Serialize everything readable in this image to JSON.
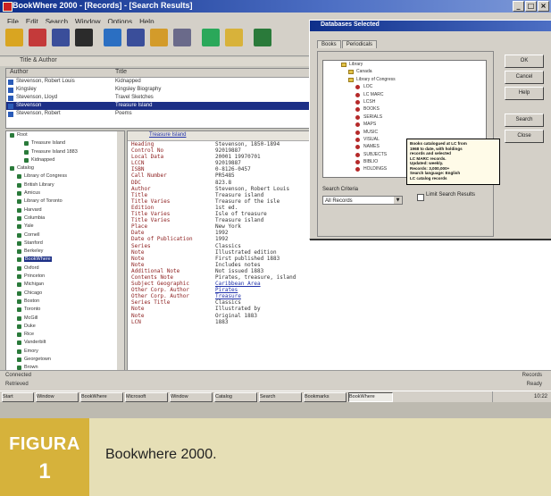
{
  "window": {
    "title": "BookWhere 2000 - [Records] - [Search Results]",
    "controls": [
      "_",
      "□",
      "×"
    ]
  },
  "menubar": [
    "File",
    "Edit",
    "Search",
    "Window",
    "Options",
    "Help"
  ],
  "toolbar": {
    "buttons": [
      {
        "name": "open-folder-icon",
        "color": "#d9a521"
      },
      {
        "name": "save-icon",
        "color": "#c43a3a"
      },
      {
        "name": "print-icon",
        "color": "#3a4e9a"
      },
      {
        "name": "help-icon",
        "color": "#2b2b2b"
      },
      {
        "name": "books-icon",
        "color": "#2b6fc2"
      },
      {
        "name": "search-icon",
        "color": "#3a4e9a"
      },
      {
        "name": "stop-icon",
        "color": "#d39b2a"
      },
      {
        "name": "view-icon",
        "color": "#6a6a8a"
      },
      {
        "name": "import-icon",
        "color": "#2aa85a"
      },
      {
        "name": "export-icon",
        "color": "#d8b23a"
      },
      {
        "name": "database-icon",
        "color": "#2a7a3a"
      }
    ]
  },
  "subheader": "Title & Author",
  "upper_list": {
    "headers": [
      "Author",
      "Title"
    ],
    "rows": [
      {
        "author": "Stevenson, Robert Louis",
        "title": "Kidnapped",
        "selected": false
      },
      {
        "author": "Kingsley",
        "title": "Kingsley Biography",
        "selected": false
      },
      {
        "author": "Stevenson, Lloyd",
        "title": "Travel Sketches",
        "selected": false
      },
      {
        "author": "Stevenson",
        "title": "Treasure Island",
        "selected": true
      },
      {
        "author": "Stevenson, Robert",
        "title": "Poems",
        "selected": false
      }
    ]
  },
  "tree": {
    "rows": [
      {
        "label": "Root",
        "indent": 0
      },
      {
        "label": "Treasure Island",
        "indent": 2
      },
      {
        "label": "Treasure Island 1883",
        "indent": 2
      },
      {
        "label": "Kidnapped",
        "indent": 2
      },
      {
        "label": "Catalog",
        "indent": 0
      },
      {
        "label": "Library of Congress",
        "indent": 1
      },
      {
        "label": "British Library",
        "indent": 1
      },
      {
        "label": "Amicus",
        "indent": 1
      },
      {
        "label": "Library of Toronto",
        "indent": 1
      },
      {
        "label": "Harvard",
        "indent": 1
      },
      {
        "label": "Columbia",
        "indent": 1
      },
      {
        "label": "Yale",
        "indent": 1
      },
      {
        "label": "Cornell",
        "indent": 1
      },
      {
        "label": "Stanford",
        "indent": 1
      },
      {
        "label": "Berkeley",
        "indent": 1
      },
      {
        "label": "BookWhere",
        "indent": 1,
        "selected": true
      },
      {
        "label": "Oxford",
        "indent": 1
      },
      {
        "label": "Princeton",
        "indent": 1
      },
      {
        "label": "Michigan",
        "indent": 1
      },
      {
        "label": "Chicago",
        "indent": 1
      },
      {
        "label": "Boston",
        "indent": 1
      },
      {
        "label": "Toronto",
        "indent": 1
      },
      {
        "label": "McGill",
        "indent": 1
      },
      {
        "label": "Duke",
        "indent": 1
      },
      {
        "label": "Rice",
        "indent": 1
      },
      {
        "label": "Vanderbilt",
        "indent": 1
      },
      {
        "label": "Emory",
        "indent": 1
      },
      {
        "label": "Georgetown",
        "indent": 1
      },
      {
        "label": "Brown",
        "indent": 1
      }
    ]
  },
  "record": {
    "header_link": "Treasure Island",
    "fields": [
      {
        "label": "Heading",
        "value": "Stevenson, 1850-1894"
      },
      {
        "label": "Control No",
        "value": "92019887"
      },
      {
        "label": "Local Data",
        "value": "20001 19970701"
      },
      {
        "label": "LCCN",
        "value": "92019887"
      },
      {
        "label": "ISBN",
        "value": "0-8126-0457"
      },
      {
        "label": "Call Number",
        "value": "PR5485"
      },
      {
        "label": "DDC",
        "value": "823.8"
      },
      {
        "label": "Author",
        "value": "Stevenson, Robert Louis"
      },
      {
        "label": "Title",
        "value": "Treasure island"
      },
      {
        "label": "Title Varies",
        "value": "Treasure of the isle"
      },
      {
        "label": "Edition",
        "value": "1st ed."
      },
      {
        "label": "Title Varies",
        "value": "Isle of treasure"
      },
      {
        "label": "Title Varies",
        "value": "Treasure island"
      },
      {
        "label": "Place",
        "value": "New York"
      },
      {
        "label": "Date",
        "value": "1992"
      },
      {
        "label": "Date of Publication",
        "value": "1992"
      },
      {
        "label": "Series",
        "value": "Classics"
      },
      {
        "label": "Note",
        "value": "Illustrated edition"
      },
      {
        "label": "Note",
        "value": "First published 1883"
      },
      {
        "label": "Note",
        "value": "Includes notes"
      },
      {
        "label": "Additional Note",
        "value": "Not issued 1883"
      },
      {
        "label": "Contents Note",
        "value": "Pirates, treasure, island"
      },
      {
        "label": "Subject Geographic",
        "value": "Caribbean Area",
        "link": true
      },
      {
        "label": "Other Corp. Author",
        "value": "Pirates",
        "link": true
      },
      {
        "label": "Other Corp. Author",
        "value": "Treasure",
        "link": true
      },
      {
        "label": "Series Title",
        "value": "Classics"
      },
      {
        "label": "Note",
        "value": "Illustrated by"
      },
      {
        "label": "Note",
        "value": "Original 1883"
      },
      {
        "label": "LCN",
        "value": "1883"
      }
    ]
  },
  "status": {
    "left1": "Connected",
    "left2": "Retrieved",
    "right1": "Records",
    "right2": "Ready"
  },
  "taskbar": {
    "items": [
      {
        "label": "Start",
        "active": false
      },
      {
        "label": "Window",
        "active": false
      },
      {
        "label": "BookWhere",
        "active": false
      },
      {
        "label": "Microsoft",
        "active": false
      },
      {
        "label": "Window",
        "active": false
      },
      {
        "label": "Catalog",
        "active": false
      },
      {
        "label": "Search",
        "active": false
      },
      {
        "label": "Bookmarks",
        "active": false
      },
      {
        "label": "BookWhere",
        "active": true
      }
    ],
    "clock": "10:22"
  },
  "dialog": {
    "title": "Databases Selected",
    "tabs": [
      "Books",
      "Periodicals"
    ],
    "tree": [
      {
        "label": "Library",
        "indent": 0,
        "type": "folder"
      },
      {
        "label": "Canada",
        "indent": 1,
        "type": "folder"
      },
      {
        "label": "Library of Congress",
        "indent": 1,
        "type": "folder"
      },
      {
        "label": "LOC",
        "indent": 2,
        "type": "bullet"
      },
      {
        "label": "LC MARC",
        "indent": 2,
        "type": "bullet"
      },
      {
        "label": "LCSH",
        "indent": 2,
        "type": "bullet"
      },
      {
        "label": "BOOKS",
        "indent": 2,
        "type": "bullet"
      },
      {
        "label": "SERIALS",
        "indent": 2,
        "type": "bullet"
      },
      {
        "label": "MAPS",
        "indent": 2,
        "type": "bullet"
      },
      {
        "label": "MUSIC",
        "indent": 2,
        "type": "bullet"
      },
      {
        "label": "VISUAL",
        "indent": 2,
        "type": "bullet"
      },
      {
        "label": "NAMES",
        "indent": 2,
        "type": "bullet"
      },
      {
        "label": "SUBJECTS",
        "indent": 2,
        "type": "bullet"
      },
      {
        "label": "BIBLIO",
        "indent": 2,
        "type": "bullet"
      },
      {
        "label": "HOLDINGS",
        "indent": 2,
        "type": "bullet"
      }
    ],
    "buttons": [
      "OK",
      "Cancel",
      "Help",
      "Search",
      "Close"
    ],
    "select_label": "Search Criteria",
    "select_value": "All Records",
    "checkbox_label": "Limit Search Results",
    "tooltip_lines": [
      "Books catalogued at LC from",
      "1968 to date, with holdings",
      "records and selected",
      "LC MARC records.",
      "Updated: weekly.",
      "Records: 3,000,000+",
      "Search language: English",
      "LC catalog records"
    ]
  },
  "caption": {
    "badge_word": "FIGURA",
    "badge_number": "1",
    "text": "Bookwhere 2000."
  }
}
